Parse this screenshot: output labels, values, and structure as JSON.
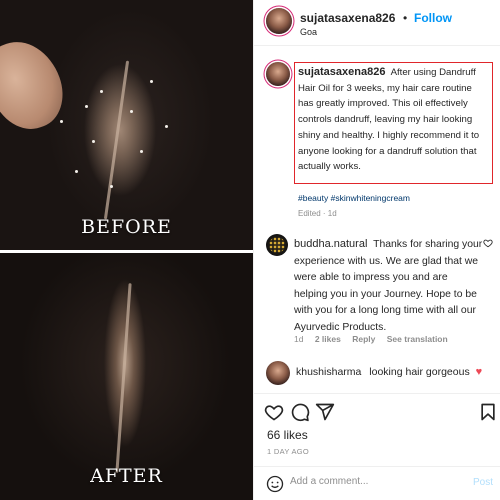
{
  "photos": {
    "before_label": "BEFORE",
    "after_label": "AFTER"
  },
  "header": {
    "username": "sujatasaxena826",
    "separator": "•",
    "follow_label": "Follow",
    "location": "Goa"
  },
  "caption": {
    "username": "sujatasaxena826",
    "text": "After using Dandruff Hair Oil for 3 weeks, my hair care routine has greatly improved. This oil effectively controls dandruff, leaving my hair looking shiny and healthy.  I highly recommend it to anyone looking for a dandruff solution that actually works.",
    "hashtags": "#beauty #skinwhiteningcream",
    "meta": "Edited · 1d",
    "highlight_color": "#e0262b"
  },
  "comments": [
    {
      "username": "buddha.natural",
      "text": "Thanks for sharing your experience with us. We are glad that we were able to impress you and are helping you in your Journey. Hope to be with you for a long long time with all our Ayurvedic Products.",
      "age": "1d",
      "likes": "2 likes",
      "reply_label": "Reply",
      "translation_label": "See translation"
    },
    {
      "username": "khushisharma",
      "text": "looking hair gorgeous",
      "emoji": "♥"
    }
  ],
  "actions": {
    "icons": [
      "heart-icon",
      "comment-icon",
      "share-icon",
      "bookmark-icon"
    ],
    "likes": "66 likes",
    "date": "1 DAY AGO"
  },
  "add_comment": {
    "placeholder": "Add a comment...",
    "post_label": "Post",
    "icon": "emoji-icon"
  },
  "colors": {
    "link_blue": "#0095f6",
    "hashtag": "#00376b",
    "muted": "#8e8e8e",
    "heart_red": "#ed4956"
  }
}
